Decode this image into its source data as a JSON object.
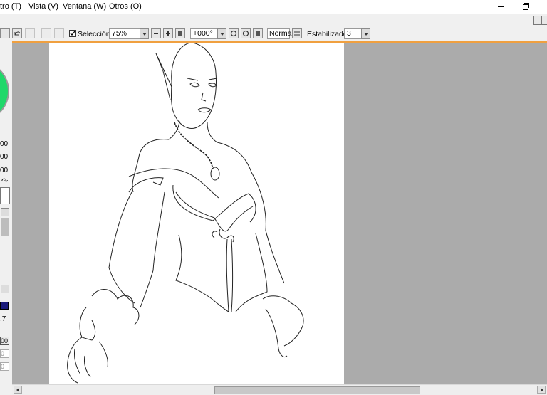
{
  "menu": {
    "items": [
      {
        "label": "tro (T)"
      },
      {
        "label": "Vista (V)"
      },
      {
        "label": "Ventana (W)"
      },
      {
        "label": "Otros (O)"
      }
    ]
  },
  "toolbar": {
    "selection_label": "Selección",
    "selection_checked": true,
    "zoom_value": "75%",
    "rotation_value": "+000°",
    "blend_mode": "Normal",
    "stabilizer_label": "Estabilizador",
    "stabilizer_value": "3"
  },
  "left_panel": {
    "values": [
      "00",
      "00",
      "00"
    ],
    "readout": ".7",
    "fields": [
      "00",
      "0",
      "0"
    ]
  },
  "colors": {
    "selection_accent": "#f0a040",
    "canvas_background": "#ababab",
    "color_wheel": "#1fd86a"
  }
}
